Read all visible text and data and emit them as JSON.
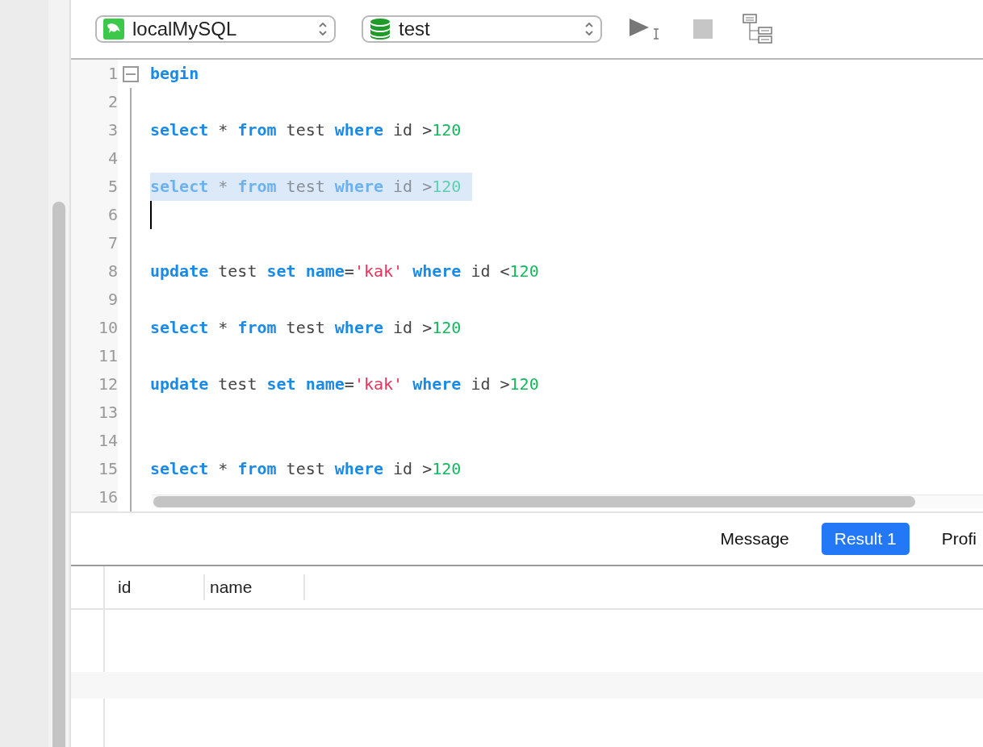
{
  "toolbar": {
    "connection": {
      "label": "localMySQL"
    },
    "database": {
      "label": "test"
    }
  },
  "editor": {
    "lines": [
      {
        "number": "1",
        "foldable": true,
        "selected": false,
        "caret": false,
        "tokens": [
          {
            "kind": "keyword",
            "text": "begin"
          }
        ]
      },
      {
        "number": "2",
        "foldable": false,
        "selected": false,
        "caret": false
      },
      {
        "number": "3",
        "foldable": false,
        "selected": false,
        "caret": false,
        "tokens": [
          {
            "kind": "keyword",
            "text": "select"
          },
          {
            "kind": "plain",
            "text": " * "
          },
          {
            "kind": "keyword",
            "text": "from"
          },
          {
            "kind": "plain",
            "text": " test "
          },
          {
            "kind": "keyword",
            "text": "where"
          },
          {
            "kind": "plain",
            "text": " id >"
          },
          {
            "kind": "number",
            "text": "120"
          }
        ]
      },
      {
        "number": "4",
        "foldable": false,
        "selected": false,
        "caret": false
      },
      {
        "number": "5",
        "foldable": false,
        "selected": true,
        "caret": false,
        "tokens": [
          {
            "kind": "keyword",
            "text": "select"
          },
          {
            "kind": "plain",
            "text": " * "
          },
          {
            "kind": "keyword",
            "text": "from"
          },
          {
            "kind": "plain",
            "text": " test "
          },
          {
            "kind": "keyword",
            "text": "where"
          },
          {
            "kind": "plain",
            "text": " id >"
          },
          {
            "kind": "number",
            "text": "120"
          }
        ]
      },
      {
        "number": "6",
        "foldable": false,
        "selected": false,
        "caret": true
      },
      {
        "number": "7",
        "foldable": false,
        "selected": false,
        "caret": false
      },
      {
        "number": "8",
        "foldable": false,
        "selected": false,
        "caret": false,
        "tokens": [
          {
            "kind": "keyword",
            "text": "update"
          },
          {
            "kind": "plain",
            "text": " test "
          },
          {
            "kind": "keyword",
            "text": "set "
          },
          {
            "kind": "keyword",
            "text": "name"
          },
          {
            "kind": "plain",
            "text": "="
          },
          {
            "kind": "string",
            "text": "'kak' "
          },
          {
            "kind": "keyword",
            "text": "where"
          },
          {
            "kind": "plain",
            "text": " id <"
          },
          {
            "kind": "number",
            "text": "120"
          }
        ]
      },
      {
        "number": "9",
        "foldable": false,
        "selected": false,
        "caret": false
      },
      {
        "number": "10",
        "foldable": false,
        "selected": false,
        "caret": false,
        "tokens": [
          {
            "kind": "keyword",
            "text": "select"
          },
          {
            "kind": "plain",
            "text": " * "
          },
          {
            "kind": "keyword",
            "text": "from"
          },
          {
            "kind": "plain",
            "text": " test "
          },
          {
            "kind": "keyword",
            "text": "where"
          },
          {
            "kind": "plain",
            "text": " id >"
          },
          {
            "kind": "number",
            "text": "120"
          }
        ]
      },
      {
        "number": "11",
        "foldable": false,
        "selected": false,
        "caret": false
      },
      {
        "number": "12",
        "foldable": false,
        "selected": false,
        "caret": false,
        "tokens": [
          {
            "kind": "keyword",
            "text": "update"
          },
          {
            "kind": "plain",
            "text": " test "
          },
          {
            "kind": "keyword",
            "text": "set "
          },
          {
            "kind": "keyword",
            "text": "name"
          },
          {
            "kind": "plain",
            "text": "="
          },
          {
            "kind": "string",
            "text": "'kak' "
          },
          {
            "kind": "keyword",
            "text": "where"
          },
          {
            "kind": "plain",
            "text": " id >"
          },
          {
            "kind": "number",
            "text": "120"
          }
        ]
      },
      {
        "number": "13",
        "foldable": false,
        "selected": false,
        "caret": false
      },
      {
        "number": "14",
        "foldable": false,
        "selected": false,
        "caret": false
      },
      {
        "number": "15",
        "foldable": false,
        "selected": false,
        "caret": false,
        "tokens": [
          {
            "kind": "keyword",
            "text": "select"
          },
          {
            "kind": "plain",
            "text": " * "
          },
          {
            "kind": "keyword",
            "text": "from"
          },
          {
            "kind": "plain",
            "text": " test "
          },
          {
            "kind": "keyword",
            "text": "where"
          },
          {
            "kind": "plain",
            "text": " id >"
          },
          {
            "kind": "number",
            "text": "120"
          }
        ]
      },
      {
        "number": "16",
        "foldable": false,
        "selected": false,
        "caret": false
      }
    ]
  },
  "result_tabs": [
    {
      "label": "Message",
      "selected": false
    },
    {
      "label": "Result 1",
      "selected": true
    },
    {
      "label": "Profi",
      "selected": false
    }
  ],
  "result_table": {
    "columns": [
      "id",
      "name"
    ]
  }
}
